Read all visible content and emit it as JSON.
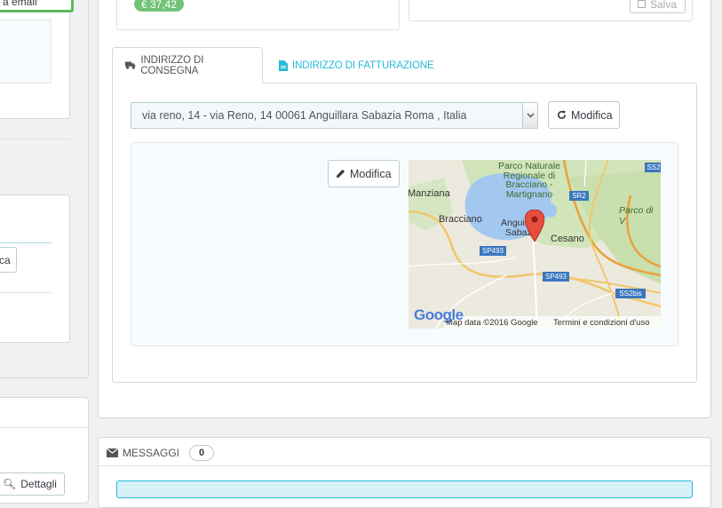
{
  "left": {
    "email_button_label": "a email",
    "modify_button_partial": "ca",
    "details_button_label": "Dettagli"
  },
  "order": {
    "price_badge": "€ 37,42",
    "save_button_label": "Salva"
  },
  "address": {
    "tabs": [
      {
        "label": "INDIRIZZO DI CONSEGNA",
        "icon": "truck-icon",
        "active": true
      },
      {
        "label": "INDIRIZZO DI FATTURAZIONE",
        "icon": "file-icon",
        "active": false
      }
    ],
    "selected_address": "via reno, 14 - via Reno, 14 00061 Anguillara Sabazia Roma , Italia",
    "change_button_label": "Modifica",
    "edit_button_label": "Modifica"
  },
  "map": {
    "labels": {
      "park": "Parco Naturale",
      "park2": "Regionale di",
      "park3": "Bracciano -",
      "park4": "Martignano",
      "manziana": "Manziana",
      "bracciano": "Bracciano",
      "anguillara": "Anguillara",
      "sabazia": "Sabazia",
      "cesano": "Cesano",
      "parco_v": "Parco di V",
      "sp493a": "SP493",
      "sp493b": "SP493",
      "sr2": "SR2",
      "ss2bis": "SS2bis",
      "ss2": "SS2"
    },
    "google_logo": "Google",
    "attribution": "Map data ©2016 Google",
    "terms": "Termini e condizioni d'uso"
  },
  "messages": {
    "title": "MESSAGGI",
    "count": "0"
  },
  "colors": {
    "accent": "#25b9d7",
    "badge_green": "#72c279",
    "highlight_green": "#5cb85c"
  }
}
